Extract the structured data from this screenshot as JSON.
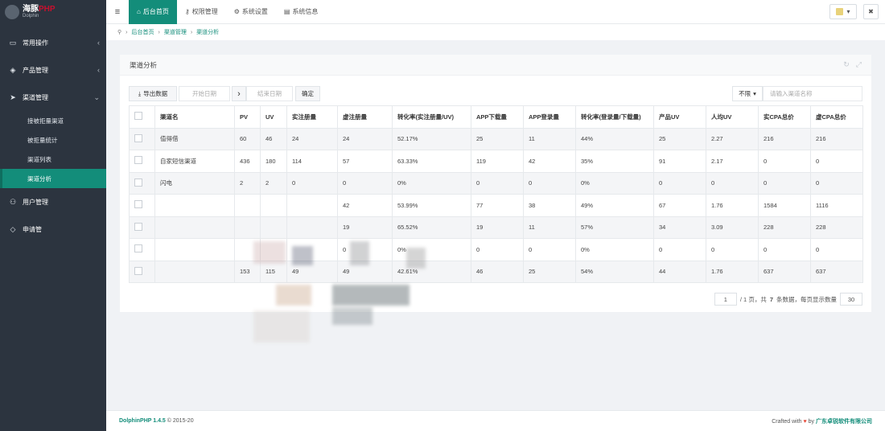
{
  "brand": {
    "title": "海豚",
    "title_accent": "PHP",
    "subtitle": "Dolphin"
  },
  "sidebar": {
    "items": [
      {
        "label": "常用操作",
        "icon": "folder-icon",
        "chevron": "‹"
      },
      {
        "label": "产品管理",
        "icon": "cube-icon",
        "chevron": "‹"
      },
      {
        "label": "渠道管理",
        "icon": "send-icon",
        "chevron": "⌄"
      }
    ],
    "subitems": [
      "接被拒量渠道",
      "被拒量统计",
      "渠道列表",
      "渠道分析"
    ],
    "bottom_items": [
      {
        "label": "用户管理",
        "icon": "users-icon"
      },
      {
        "label": "申请管",
        "icon": "tag-icon"
      }
    ]
  },
  "topbar": {
    "tabs": [
      {
        "label": "后台首页",
        "icon": "home-icon"
      },
      {
        "label": "权限管理",
        "icon": "key-icon"
      },
      {
        "label": "系统设置",
        "icon": "gear-icon"
      },
      {
        "label": "系统信息",
        "icon": "document-icon"
      }
    ],
    "user_btn": "▾",
    "trash_icon": "🗑"
  },
  "breadcrumb": [
    "后台首页",
    "渠道管理",
    "渠道分析"
  ],
  "panel": {
    "title": "渠道分析"
  },
  "toolbar": {
    "export": "导出数据",
    "start_date": "开始日期",
    "arrow": "›",
    "end_date": "结束日期",
    "confirm": "确定",
    "filter_select": "不限",
    "search_placeholder": "请输入渠道名称"
  },
  "table": {
    "headers": [
      "渠道名",
      "PV",
      "UV",
      "实注册量",
      "虚注册量",
      "转化率(实注册量/UV)",
      "APP下载量",
      "APP登录量",
      "转化率(登录量/下载量)",
      "产品UV",
      "人均UV",
      "实CPA总价",
      "虚CPA总价"
    ],
    "rows": [
      [
        "值得借",
        "60",
        "46",
        "24",
        "24",
        "52.17%",
        "25",
        "11",
        "44%",
        "25",
        "2.27",
        "216",
        "216"
      ],
      [
        "自家短信渠道",
        "436",
        "180",
        "114",
        "57",
        "63.33%",
        "119",
        "42",
        "35%",
        "91",
        "2.17",
        "0",
        "0"
      ],
      [
        "闪电",
        "2",
        "2",
        "0",
        "0",
        "0%",
        "0",
        "0",
        "0%",
        "0",
        "0",
        "0",
        "0"
      ],
      [
        "",
        "",
        "",
        "",
        "42",
        "53.99%",
        "77",
        "38",
        "49%",
        "67",
        "1.76",
        "1584",
        "1116"
      ],
      [
        "",
        "",
        "",
        "",
        "19",
        "65.52%",
        "19",
        "11",
        "57%",
        "34",
        "3.09",
        "228",
        "228"
      ],
      [
        "",
        "",
        "",
        "",
        "0",
        "0%",
        "0",
        "0",
        "0%",
        "0",
        "0",
        "0",
        "0"
      ],
      [
        "",
        "153",
        "115",
        "49",
        "49",
        "42.61%",
        "46",
        "25",
        "54%",
        "44",
        "1.76",
        "637",
        "637"
      ]
    ]
  },
  "pager": {
    "page": "1",
    "total_text": "/ 1 页，共",
    "count": "7",
    "count_suffix": "条数据，每页显示数量",
    "per_page": "30"
  },
  "footer": {
    "brand": "DolphinPHP 1.4.5",
    "copy": "© 2015-20",
    "crafted": "Crafted with",
    "by": "by",
    "company": "广东卓锐软件有限公司"
  }
}
